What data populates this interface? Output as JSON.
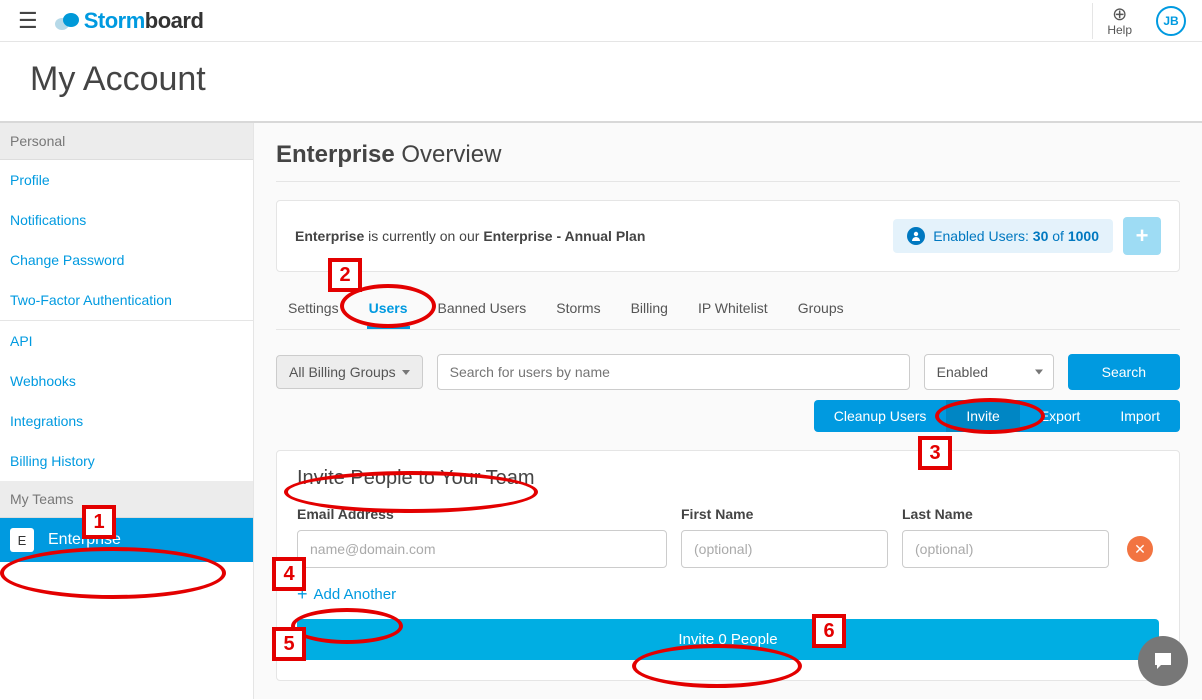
{
  "topbar": {
    "logo1": "Storm",
    "logo2": "board",
    "help": "Help",
    "avatar": "JB"
  },
  "page_title": "My Account",
  "sidebar": {
    "personal_header": "Personal",
    "links": [
      "Profile",
      "Notifications",
      "Change Password",
      "Two-Factor Authentication",
      "API",
      "Webhooks",
      "Integrations",
      "Billing History"
    ],
    "teams_header": "My Teams",
    "team": {
      "initial": "E",
      "name": "Enterprise"
    }
  },
  "content": {
    "title_bold": "Enterprise",
    "title_rest": " Overview",
    "plan_pre": "Enterprise",
    "plan_mid": " is currently on our ",
    "plan_bold": "Enterprise - Annual Plan",
    "enabled_label": "Enabled Users: ",
    "enabled_count": "30",
    "enabled_of": " of ",
    "enabled_total": "1000",
    "tabs": [
      "Settings",
      "Users",
      "Banned Users",
      "Storms",
      "Billing",
      "IP Whitelist",
      "Groups"
    ],
    "active_tab": 1,
    "billing_group": "All Billing Groups",
    "search_placeholder": "Search for users by name",
    "status": "Enabled",
    "search_btn": "Search",
    "actions": [
      "Cleanup Users",
      "Invite",
      "Export",
      "Import"
    ],
    "active_action": 1,
    "invite_title": "Invite People to Your Team",
    "labels": {
      "email": "Email Address",
      "first": "First Name",
      "last": "Last Name"
    },
    "placeholders": {
      "email": "name@domain.com",
      "first": "(optional)",
      "last": "(optional)"
    },
    "add_another": "Add Another",
    "invite_button": "Invite 0 People"
  },
  "annotations": {
    "n1": "1",
    "n2": "2",
    "n3": "3",
    "n4": "4",
    "n5": "5",
    "n6": "6"
  }
}
